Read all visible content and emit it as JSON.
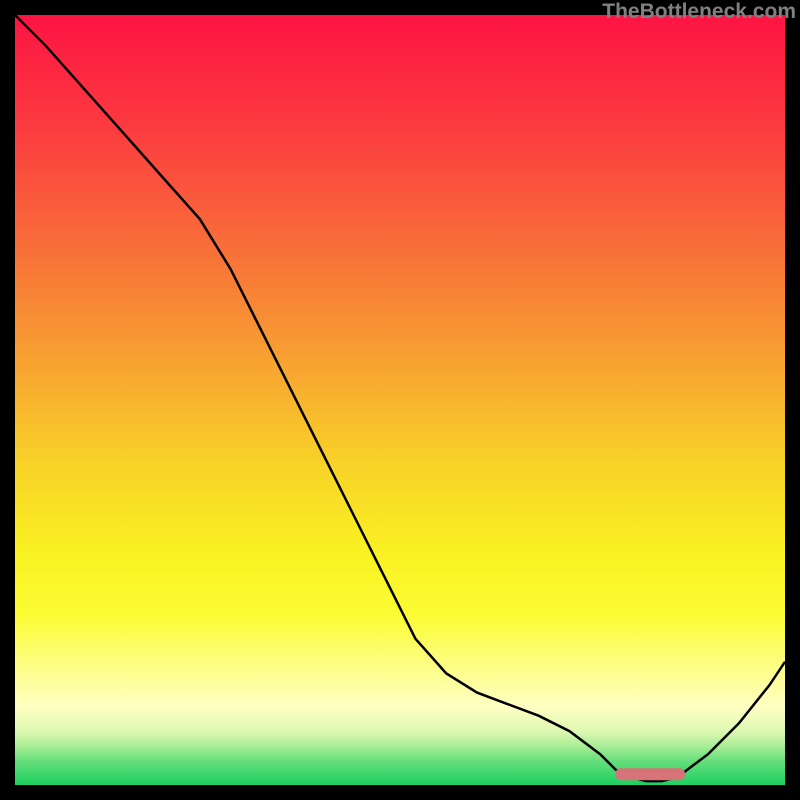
{
  "attribution": "TheBottleneck.com",
  "chart_data": {
    "type": "line",
    "title": "",
    "xlabel": "",
    "ylabel": "",
    "xlim": [
      0,
      100
    ],
    "ylim": [
      0,
      100
    ],
    "series": [
      {
        "name": "curve",
        "x": [
          0,
          4,
          8,
          12,
          16,
          20,
          24,
          28,
          32,
          36,
          40,
          44,
          48,
          52,
          56,
          60,
          64,
          68,
          72,
          76,
          78,
          80,
          82,
          84,
          86,
          90,
          94,
          98,
          100
        ],
        "y": [
          100,
          96,
          91.5,
          87,
          82.5,
          78,
          73.5,
          67,
          59,
          51,
          43,
          35,
          27,
          19,
          14.5,
          12,
          10.5,
          9,
          7,
          4,
          2,
          1,
          0.5,
          0.5,
          1,
          4,
          8,
          13,
          16
        ]
      }
    ],
    "marker": {
      "x_start": 78,
      "x_end": 87,
      "y": 1.4,
      "color": "#d77378"
    },
    "background_gradient": {
      "stops": [
        {
          "offset": 0,
          "color": "#fd1443"
        },
        {
          "offset": 15,
          "color": "#fb3c3f"
        },
        {
          "offset": 30,
          "color": "#f86e39"
        },
        {
          "offset": 45,
          "color": "#f7a231"
        },
        {
          "offset": 58,
          "color": "#f8d128"
        },
        {
          "offset": 70,
          "color": "#faf222"
        },
        {
          "offset": 78,
          "color": "#fbfc34"
        },
        {
          "offset": 85,
          "color": "#fdfe8a"
        },
        {
          "offset": 90,
          "color": "#feffc3"
        },
        {
          "offset": 93,
          "color": "#def8b2"
        },
        {
          "offset": 95,
          "color": "#a8ed95"
        },
        {
          "offset": 97,
          "color": "#62de7a"
        },
        {
          "offset": 100,
          "color": "#1ecf61"
        }
      ]
    }
  }
}
